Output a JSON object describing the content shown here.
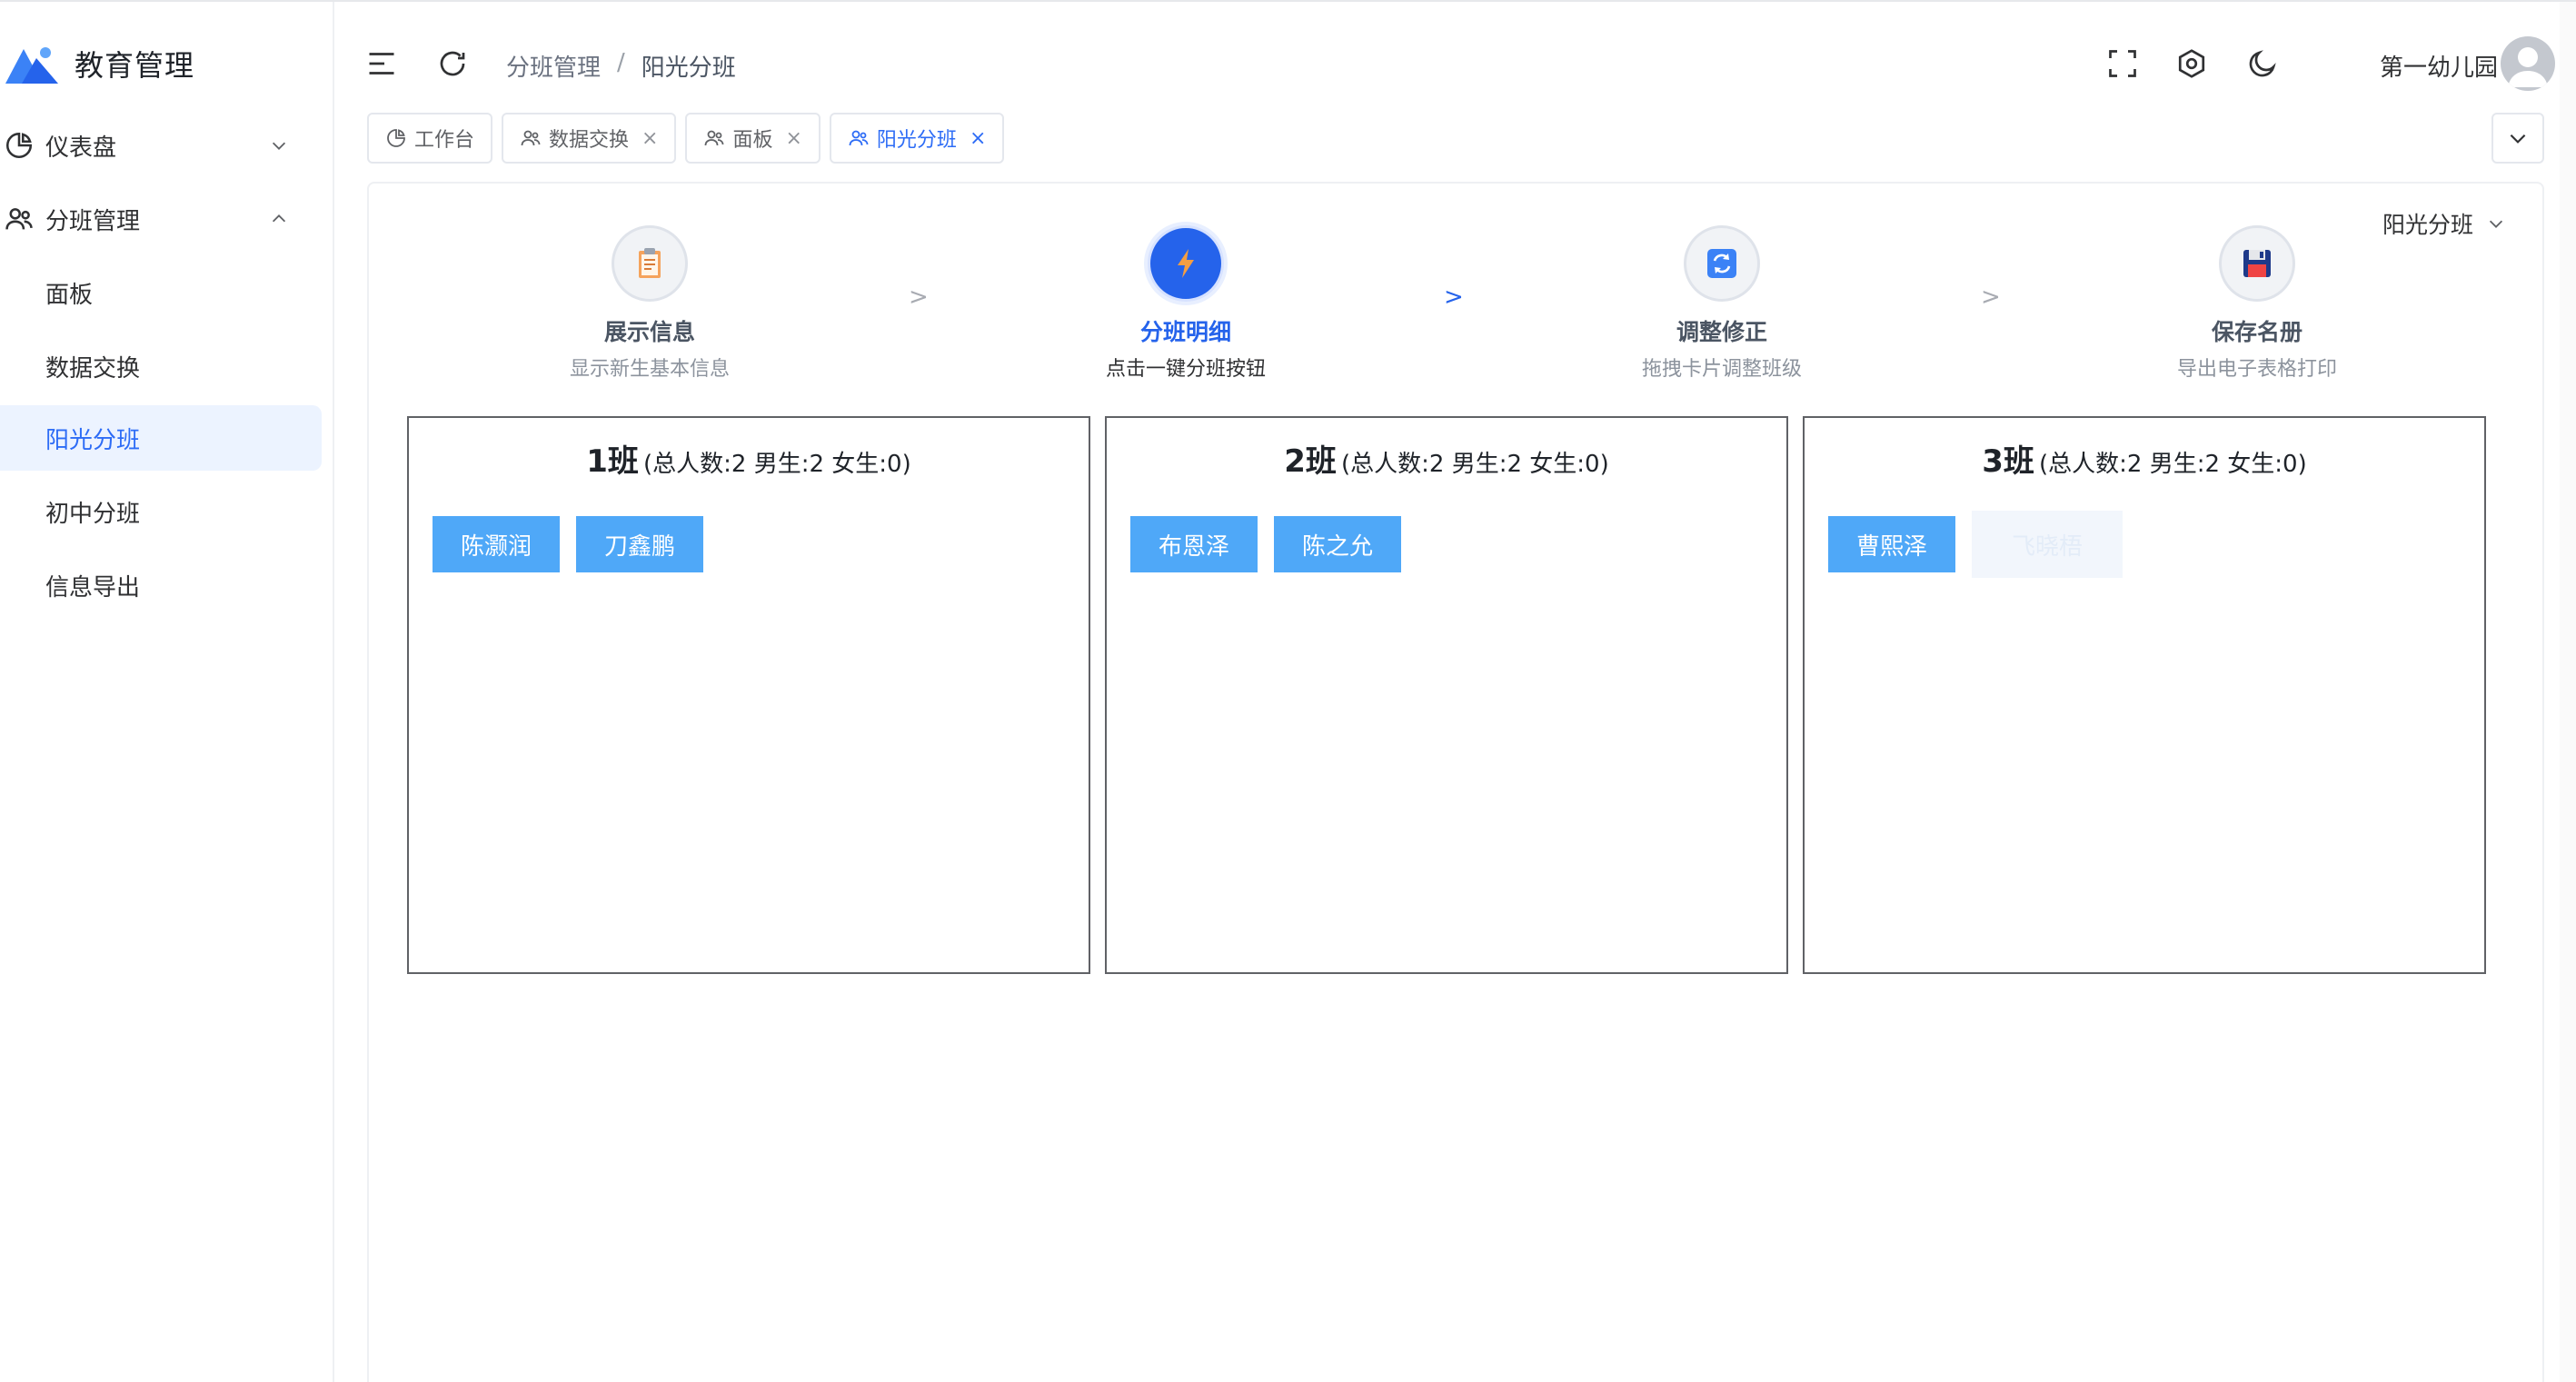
{
  "app": {
    "title": "教育管理",
    "accent_color": "#2d6cf6"
  },
  "sidebar": {
    "menus": [
      {
        "label": "仪表盘",
        "icon": "pie-chart-icon",
        "expanded": false
      },
      {
        "label": "分班管理",
        "icon": "users-icon",
        "expanded": true
      }
    ],
    "sub_items": [
      {
        "label": "面板",
        "active": false
      },
      {
        "label": "数据交换",
        "active": false
      },
      {
        "label": "阳光分班",
        "active": true
      },
      {
        "label": "初中分班",
        "active": false
      },
      {
        "label": "信息导出",
        "active": false
      }
    ]
  },
  "header": {
    "breadcrumb": [
      "分班管理",
      "阳光分班"
    ],
    "breadcrumb_sep": "/",
    "user_name": "第一幼儿园",
    "icons": [
      "menu-fold-icon",
      "refresh-icon",
      "fullscreen-icon",
      "settings-icon",
      "moon-icon"
    ]
  },
  "tabs": [
    {
      "label": "工作台",
      "icon": "pie-chart-icon",
      "closable": false,
      "active": false
    },
    {
      "label": "数据交换",
      "icon": "users-icon",
      "closable": true,
      "active": false
    },
    {
      "label": "面板",
      "icon": "users-icon",
      "closable": true,
      "active": false
    },
    {
      "label": "阳光分班",
      "icon": "users-icon",
      "closable": true,
      "active": true
    }
  ],
  "tab_close_glyph": "×",
  "school_select": {
    "value": "阳光分班"
  },
  "steps": [
    {
      "title": "展示信息",
      "desc": "显示新生基本信息",
      "icon": "clipboard-icon",
      "active": false
    },
    {
      "title": "分班明细",
      "desc": "点击一键分班按钮",
      "icon": "lightning-icon",
      "active": true
    },
    {
      "title": "调整修正",
      "desc": "拖拽卡片调整班级",
      "icon": "swap-icon",
      "active": false
    },
    {
      "title": "保存名册",
      "desc": "导出电子表格打印",
      "icon": "floppy-disk-icon",
      "active": false
    }
  ],
  "step_arrow": ">",
  "classes": [
    {
      "name": "1班",
      "stats": "(总人数:2 男生:2 女生:0)",
      "students": [
        "陈灏润",
        "刀鑫鹏"
      ]
    },
    {
      "name": "2班",
      "stats": "(总人数:2 男生:2 女生:0)",
      "students": [
        "布恩泽",
        "陈之允"
      ]
    },
    {
      "name": "3班",
      "stats": "(总人数:2 男生:2 女生:0)",
      "students": [
        "曹熙泽"
      ],
      "dragging": "飞晓梧"
    }
  ]
}
